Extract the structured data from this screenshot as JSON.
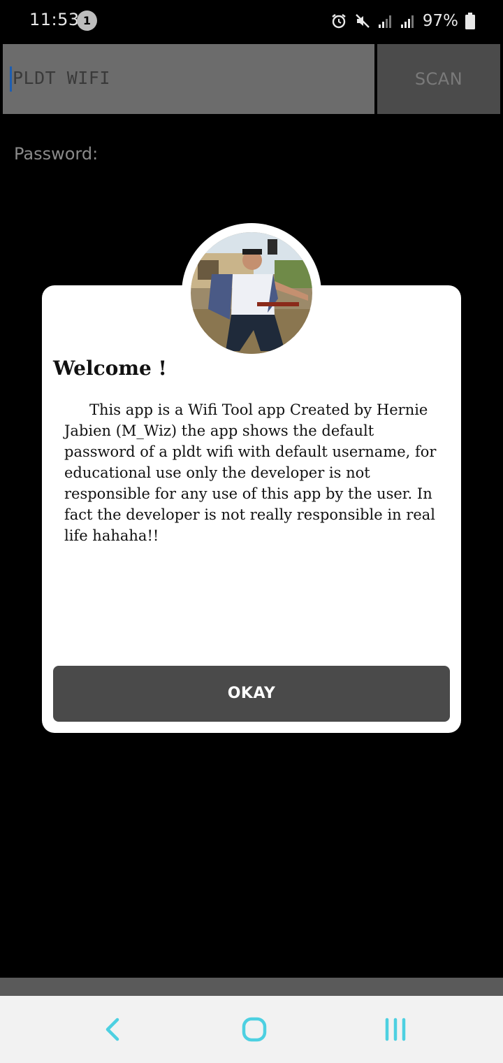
{
  "status_bar": {
    "time": "11:53",
    "notification_count": "1",
    "battery": "97%",
    "icons": [
      "alarm-icon",
      "mute-icon",
      "signal-icon",
      "signal-icon",
      "battery-icon"
    ]
  },
  "form": {
    "ssid_value": "PLDT WIFI",
    "scan_label": "SCAN",
    "password_label": "Password:"
  },
  "dialog": {
    "title": "Welcome !",
    "body": "This app is a Wifi Tool app Created by Hernie Jabien (M_Wiz) the app shows the default password of a pldt wifi with default username, for educational use only the developer is not responsible for any use of this app by the user. In fact the developer is not really responsible in real life hahaha!!",
    "okay_label": "OKAY"
  },
  "colors": {
    "accent_nav": "#4dd0e1",
    "dialog_button": "#4a4a4a",
    "input_bg": "#6c6c6c",
    "scan_bg": "#4b4b4b"
  },
  "nav_bar": {
    "icons": [
      "back-icon",
      "home-icon",
      "recents-icon"
    ]
  }
}
